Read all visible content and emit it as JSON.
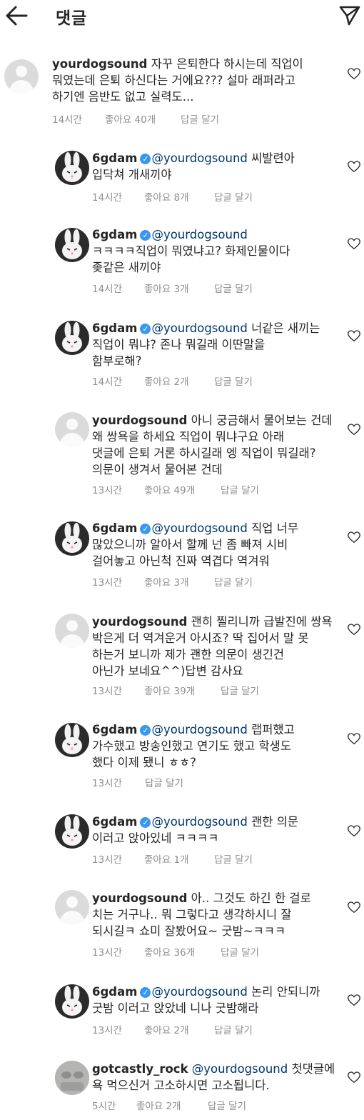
{
  "header": {
    "title": "댓글",
    "back_icon": "arrow-left-icon",
    "send_icon": "paper-plane-icon"
  },
  "comments": [
    {
      "avatar": "default-avatar",
      "user": "yourdogsound",
      "verified": false,
      "mention": "",
      "lines": [
        "자꾸 은퇴한다 하시는데 직업이",
        "뭐였는데 은퇴 하신다는 거에요??? 설마 래퍼라고",
        "하기엔 음반도 없고 실력도..."
      ],
      "time": "14시간",
      "likes": "좋아요 40개",
      "reply": "답글 달기"
    },
    {
      "avatar": "bunny-avatar",
      "user": "6gdam",
      "verified": true,
      "mention": "@yourdogsound",
      "lines": [
        "씨발련아",
        "입닥쳐 개새끼야"
      ],
      "time": "14시간",
      "likes": "좋아요 8개",
      "reply": "답글 달기"
    },
    {
      "avatar": "bunny-avatar",
      "user": "6gdam",
      "verified": true,
      "mention": "@yourdogsound",
      "lines": [
        "",
        "ㅋㅋㅋㅋ직업이 뭐였냐고? 화제인물이다",
        "좆같은 새끼야"
      ],
      "time": "14시간",
      "likes": "좋아요 3개",
      "reply": "답글 달기"
    },
    {
      "avatar": "bunny-avatar",
      "user": "6gdam",
      "verified": true,
      "mention": "@yourdogsound",
      "lines": [
        "너같은 새끼는",
        "직업이 뭐냐? 존나 뭐길래 이딴말을",
        "함부로해?"
      ],
      "time": "14시간",
      "likes": "좋아요 2개",
      "reply": "답글 달기"
    },
    {
      "avatar": "default-avatar",
      "user": "yourdogsound",
      "verified": false,
      "mention": "",
      "lines": [
        "아니 궁금해서 물어보는 건데",
        "왜 쌍욕을 하세요 직업이 뭐냐구요 아래",
        "댓글에 은퇴 거론 하시길래 엥 직업이 뭐길래?",
        "의문이 생겨서 물어본 건데"
      ],
      "time": "13시간",
      "likes": "좋아요 49개",
      "reply": "답글 달기"
    },
    {
      "avatar": "bunny-avatar",
      "user": "6gdam",
      "verified": true,
      "mention": "@yourdogsound",
      "lines": [
        "직업 너무",
        "많았으니까 알아서 할께 넌 좀 빠져 시비",
        "걸어놓고 아닌척 진짜 역겹다 역겨워"
      ],
      "time": "13시간",
      "likes": "좋아요 3개",
      "reply": "답글 달기"
    },
    {
      "avatar": "default-avatar",
      "user": "yourdogsound",
      "verified": false,
      "mention": "",
      "lines": [
        "괜히 찔리니까 급발진에 쌍욕",
        "박은게 더 역겨운거 아시죠? 딱 집어서 말 못",
        "하는거 보니까 제가 괜한 의문이 생긴건",
        "아닌가 보네요^^)답변 감사요"
      ],
      "time": "13시간",
      "likes": "좋아요 39개",
      "reply": "답글 달기"
    },
    {
      "avatar": "bunny-avatar",
      "user": "6gdam",
      "verified": true,
      "mention": "@yourdogsound",
      "lines": [
        "랩퍼했고",
        "가수했고 방송인했고 연기도 했고 학생도",
        "했다 이제 됐니 ㅎㅎ?"
      ],
      "time": "13시간",
      "likes": "",
      "reply": "답글 달기"
    },
    {
      "avatar": "bunny-avatar",
      "user": "6gdam",
      "verified": true,
      "mention": "@yourdogsound",
      "lines": [
        "괜한 의문",
        "이러고 앉아있네 ㅋㅋㅋㅋ"
      ],
      "time": "13시간",
      "likes": "좋아요 1개",
      "reply": "답글 달기"
    },
    {
      "avatar": "default-avatar",
      "user": "yourdogsound",
      "verified": false,
      "mention": "",
      "lines": [
        "아.. 그것도 하긴 한 걸로",
        "치는 거구나.. 뭐 그렇다고 생각하시니 잘",
        "되시길ㅋ 쇼미 잘봤어요~ 굿밤~ㅋㅋㅋ"
      ],
      "time": "13시간",
      "likes": "좋아요 36개",
      "reply": "답글 달기"
    },
    {
      "avatar": "bunny-avatar",
      "user": "6gdam",
      "verified": true,
      "mention": "@yourdogsound",
      "lines": [
        "논리 안되니까",
        "굿밤 이러고 앉았네 니나 굿밤해라"
      ],
      "time": "13시간",
      "likes": "좋아요 2개",
      "reply": "답글 달기"
    },
    {
      "avatar": "photo-avatar",
      "user": "gotcastly_rock",
      "verified": false,
      "mention": "@yourdogsound",
      "lines": [
        "첫댓글에",
        "욕 먹으신거 고소하시면 고소됩니다."
      ],
      "time": "5시간",
      "likes": "좋아요 2개",
      "reply": "답글 달기"
    }
  ]
}
